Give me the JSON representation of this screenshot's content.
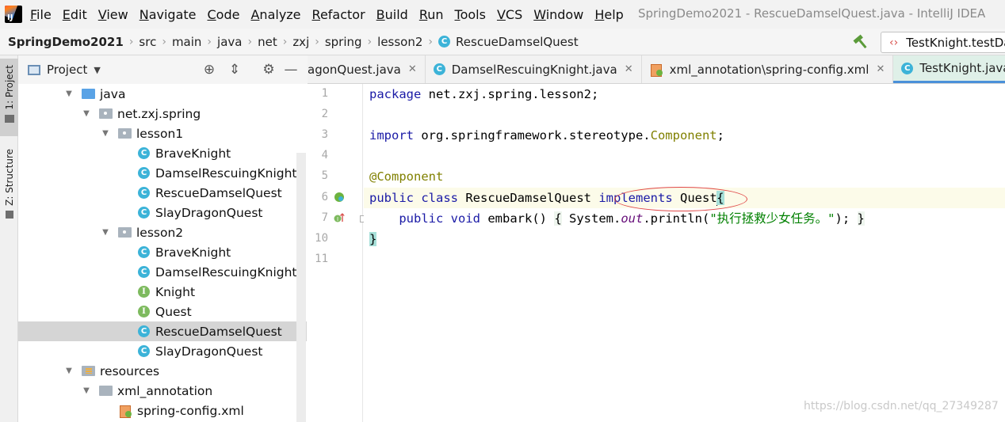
{
  "app": {
    "logo_text": "IJ",
    "window_title": "SpringDemo2021 - RescueDamselQuest.java - IntelliJ IDEA"
  },
  "menu": [
    "File",
    "Edit",
    "View",
    "Navigate",
    "Code",
    "Analyze",
    "Refactor",
    "Build",
    "Run",
    "Tools",
    "VCS",
    "Window",
    "Help"
  ],
  "breadcrumb": {
    "project": "SpringDemo2021",
    "parts": [
      "src",
      "main",
      "java",
      "net",
      "zxj",
      "spring",
      "lesson2"
    ],
    "file": "RescueDamselQuest"
  },
  "run_config": {
    "label": "TestKnight.testDa"
  },
  "tool_stripe": {
    "project_tab": "1: Project",
    "structure_tab": "Z: Structure"
  },
  "project_panel": {
    "title": "Project",
    "tree": [
      {
        "label": "java",
        "icon": "folder-src",
        "arrow": "down"
      },
      {
        "label": "net.zxj.spring",
        "icon": "package",
        "arrow": "down"
      },
      {
        "label": "lesson1",
        "icon": "package",
        "arrow": "down"
      },
      {
        "label": "BraveKnight",
        "icon": "class"
      },
      {
        "label": "DamselRescuingKnight",
        "icon": "class"
      },
      {
        "label": "RescueDamselQuest",
        "icon": "class"
      },
      {
        "label": "SlayDragonQuest",
        "icon": "class"
      },
      {
        "label": "lesson2",
        "icon": "package",
        "arrow": "down"
      },
      {
        "label": "BraveKnight",
        "icon": "class"
      },
      {
        "label": "DamselRescuingKnight",
        "icon": "class"
      },
      {
        "label": "Knight",
        "icon": "interface"
      },
      {
        "label": "Quest",
        "icon": "interface"
      },
      {
        "label": "RescueDamselQuest",
        "icon": "class",
        "selected": true
      },
      {
        "label": "SlayDragonQuest",
        "icon": "class"
      },
      {
        "label": "resources",
        "icon": "folder-resources",
        "arrow": "down"
      },
      {
        "label": "xml_annotation",
        "icon": "folder",
        "arrow": "down"
      },
      {
        "label": "spring-config.xml",
        "icon": "xml"
      }
    ]
  },
  "tabs": [
    {
      "label": "agonQuest.java",
      "icon": "none",
      "close": "✕"
    },
    {
      "label": "DamselRescuingKnight.java",
      "icon": "class",
      "close": "✕"
    },
    {
      "label": "xml_annotation\\spring-config.xml",
      "icon": "xml",
      "close": "✕"
    },
    {
      "label": "TestKnight.java",
      "icon": "class",
      "close": "✕",
      "active": true
    }
  ],
  "editor": {
    "line_numbers": [
      "1",
      "2",
      "3",
      "4",
      "5",
      "6",
      "7",
      "10",
      "11"
    ],
    "lines": {
      "l1_kw": "package",
      "l1_rest": " net.zxj.spring.lesson2;",
      "l3_kw": "import",
      "l3_pkg": " org.springframework.stereotype.",
      "l3_cls": "Component",
      "l3_end": ";",
      "l5_ann": "@Component",
      "l6_kw1": "public",
      "l6_kw2": "class",
      "l6_name": " RescueDamselQuest ",
      "l6_kw3": "implements",
      "l6_iface": " Quest",
      "l6_brace": "{",
      "l7_indent": "    ",
      "l7_kw1": "public",
      "l7_kw2": "void",
      "l7_method": " embark() ",
      "l7_open": "{",
      "l7_sys": " System.",
      "l7_out": "out",
      "l7_call": ".println(",
      "l7_str": "\"执行拯救少女任务。\"",
      "l7_tail": "); ",
      "l7_close": "}",
      "l10_brace": "}"
    }
  },
  "watermark": "https://blog.csdn.net/qq_27349287",
  "colors": {
    "keyword": "#1a1aa6",
    "annotation": "#808000",
    "string": "#008000",
    "highlight_ellipse": "#e04848"
  }
}
